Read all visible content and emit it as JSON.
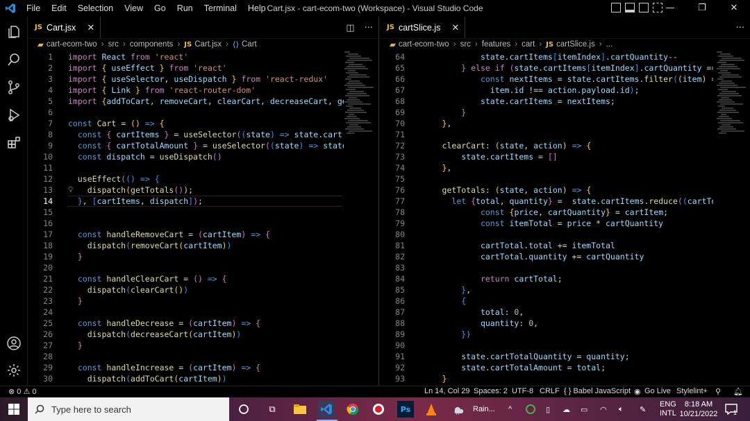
{
  "window": {
    "title": "Cart.jsx - cart-ecom-two (Workspace) - Visual Studio Code",
    "menu": [
      "File",
      "Edit",
      "Selection",
      "View",
      "Go",
      "Run",
      "Terminal",
      "Help"
    ]
  },
  "left_editor": {
    "tab_label": "Cart.jsx",
    "tab_badge": "JS",
    "breadcrumb": [
      "cart-ecom-two",
      "src",
      "components",
      "Cart.jsx",
      "Cart"
    ],
    "cursor_line": 14,
    "lines": [
      {
        "n": "1",
        "html": "<span class='kw2'>import</span> <span class='var'>React</span> <span class='kw2'>from</span> <span class='str'>'react'</span>"
      },
      {
        "n": "2",
        "html": "<span class='kw2'>import</span> <span class='br1'>{</span> <span class='var'>useEffect</span> <span class='br1'>}</span> <span class='kw2'>from</span> <span class='str'>'react'</span>"
      },
      {
        "n": "3",
        "html": "<span class='kw2'>import</span> <span class='br1'>{</span> <span class='var'>useSelector</span>, <span class='var'>useDispatch</span> <span class='br1'>}</span> <span class='kw2'>from</span> <span class='str'>'react-redux'</span>"
      },
      {
        "n": "4",
        "html": "<span class='kw2'>import</span> <span class='br1'>{</span> <span class='var'>Link</span> <span class='br1'>}</span> <span class='kw2'>from</span> <span class='str'>'react-router-dom'</span>"
      },
      {
        "n": "5",
        "html": "<span class='kw2'>import</span> <span class='br1'>{</span><span class='var'>addToCart</span>, <span class='var'>removeCart</span>, <span class='var'>clearCart</span>, <span class='var'>decreaseCart</span>, <span class='var'>getTo</span>"
      },
      {
        "n": "6",
        "html": ""
      },
      {
        "n": "7",
        "html": "<span class='kw'>const</span> <span class='fn'>Cart</span> = <span class='br1'>()</span> <span class='kw'>=&gt;</span> <span class='br1'>{</span>"
      },
      {
        "n": "8",
        "html": "  <span class='kw'>const</span> <span class='br2'>{</span> <span class='var'>cartItems</span> <span class='br2'>}</span> = <span class='fn'>useSelector</span><span class='br2'>(</span><span class='br3'>(</span><span class='var'>state</span><span class='br3'>)</span> <span class='kw'>=&gt;</span> <span class='var'>state</span>.<span class='prop'>cart</span><span class='br2'>)</span>"
      },
      {
        "n": "9",
        "html": "  <span class='kw'>const</span> <span class='br2'>{</span> <span class='var'>cartTotalAmount</span> <span class='br2'>}</span> = <span class='fn'>useSelector</span><span class='br2'>(</span><span class='br3'>(</span><span class='var'>state</span><span class='br3'>)</span> <span class='kw'>=&gt;</span> <span class='var'>state</span>.<span class='prop'>ca</span>"
      },
      {
        "n": "10",
        "html": "  <span class='kw'>const</span> <span class='var'>dispatch</span> = <span class='fn'>useDispatch</span><span class='br2'>()</span>"
      },
      {
        "n": "11",
        "html": ""
      },
      {
        "n": "12",
        "html": "  <span class='fn'>useEffect</span><span class='br2'>(</span><span class='br3'>()</span> <span class='kw'>=&gt;</span> <span class='br3'>{</span>"
      },
      {
        "n": "13",
        "html": "    <span class='fn'>dispatch</span><span class='br1'>(</span><span class='fn'>getTotals</span><span class='br2'>()</span><span class='br1'>)</span>;"
      },
      {
        "n": "14",
        "html": "  <span class='br3'>}</span>, <span class='br3'>[</span><span class='var'>cartItems</span>, <span class='var'>dispatch</span><span class='br3'>]</span><span class='br2'>)</span>;"
      },
      {
        "n": "15",
        "html": ""
      },
      {
        "n": "16",
        "html": ""
      },
      {
        "n": "17",
        "html": "  <span class='kw'>const</span> <span class='fn'>handleRemoveCart</span> = <span class='br2'>(</span><span class='var'>cartItem</span><span class='br2'>)</span> <span class='kw'>=&gt;</span> <span class='br2'>{</span>"
      },
      {
        "n": "18",
        "html": "    <span class='fn'>dispatch</span><span class='br3'>(</span><span class='fn'>removeCart</span><span class='br1'>(</span><span class='var'>cartItem</span><span class='br1'>)</span><span class='br3'>)</span>"
      },
      {
        "n": "19",
        "html": "  <span class='br2'>}</span>"
      },
      {
        "n": "20",
        "html": ""
      },
      {
        "n": "21",
        "html": "  <span class='kw'>const</span> <span class='fn'>handleClearCart</span> = <span class='br2'>()</span> <span class='kw'>=&gt;</span> <span class='br2'>{</span>"
      },
      {
        "n": "22",
        "html": "    <span class='fn'>dispatch</span><span class='br3'>(</span><span class='fn'>clearCart</span><span class='br1'>()</span><span class='br3'>)</span>"
      },
      {
        "n": "23",
        "html": "  <span class='br2'>}</span>"
      },
      {
        "n": "24",
        "html": ""
      },
      {
        "n": "25",
        "html": "  <span class='kw'>const</span> <span class='fn'>handleDecrease</span> = <span class='br2'>(</span><span class='var'>cartItem</span><span class='br2'>)</span> <span class='kw'>=&gt;</span> <span class='br2'>{</span>"
      },
      {
        "n": "26",
        "html": "    <span class='fn'>dispatch</span><span class='br3'>(</span><span class='fn'>decreaseCart</span><span class='br1'>(</span><span class='var'>cartItem</span><span class='br1'>)</span><span class='br3'>)</span>"
      },
      {
        "n": "27",
        "html": "  <span class='br2'>}</span>"
      },
      {
        "n": "28",
        "html": ""
      },
      {
        "n": "29",
        "html": "  <span class='kw'>const</span> <span class='fn'>handleIncrease</span> = <span class='br2'>(</span><span class='var'>cartItem</span><span class='br2'>)</span> <span class='kw'>=&gt;</span> <span class='br2'>{</span>"
      },
      {
        "n": "30",
        "html": "    <span class='fn'>dispatch</span><span class='br3'>(</span><span class='fn'>addToCart</span><span class='br1'>(</span><span class='var'>cartItem</span><span class='br1'>)</span><span class='br3'>)</span>"
      }
    ]
  },
  "right_editor": {
    "tab_label": "cartSlice.js",
    "tab_badge": "JS",
    "breadcrumb": [
      "cart-ecom-two",
      "src",
      "features",
      "cart",
      "cartSlice.js",
      "..."
    ],
    "lines": [
      {
        "n": "64",
        "html": "              <span class='var'>state</span>.<span class='prop'>cartItems</span><span class='br3'>[</span><span class='var'>itemIndex</span><span class='br3'>]</span>.<span class='prop'>cartQuantity</span>--"
      },
      {
        "n": "65",
        "html": "          <span class='br2'>}</span> <span class='kw2'>else</span> <span class='kw2'>if</span> <span class='br2'>(</span><span class='var'>state</span>.<span class='prop'>cartItems</span><span class='br3'>[</span><span class='var'>itemIndex</span><span class='br3'>]</span>.<span class='prop'>cartQuantity</span> =="
      },
      {
        "n": "66",
        "html": "              <span class='kw'>const</span> <span class='var'>nextItems</span> = <span class='var'>state</span>.<span class='prop'>cartItems</span>.<span class='fn'>filter</span><span class='br3'>(</span><span class='br1'>(</span><span class='var'>item</span><span class='br1'>)</span> ="
      },
      {
        "n": "67",
        "html": "                <span class='var'>item</span>.<span class='prop'>id</span> !== <span class='var'>action</span>.<span class='prop'>payload</span>.<span class='prop'>id</span><span class='br3'>)</span>;"
      },
      {
        "n": "68",
        "html": "              <span class='var'>state</span>.<span class='prop'>cartItems</span> = <span class='var'>nextItems</span>;"
      },
      {
        "n": "69",
        "html": "          <span class='br2'>}</span>"
      },
      {
        "n": "70",
        "html": "      <span class='br1'>}</span>,"
      },
      {
        "n": "71",
        "html": ""
      },
      {
        "n": "72",
        "html": "      <span class='fn'>clearCart</span>: <span class='br1'>(</span><span class='var'>state</span>, <span class='var'>action</span><span class='br1'>)</span> <span class='kw'>=&gt;</span> <span class='br1'>{</span>"
      },
      {
        "n": "73",
        "html": "          <span class='var'>state</span>.<span class='prop'>cartItems</span> = <span class='br2'>[]</span>"
      },
      {
        "n": "74",
        "html": "      <span class='br1'>}</span>,"
      },
      {
        "n": "75",
        "html": ""
      },
      {
        "n": "76",
        "html": "      <span class='fn'>getTotals</span>: <span class='br1'>(</span><span class='var'>state</span>, <span class='var'>action</span><span class='br1'>)</span> <span class='kw'>=&gt;</span> <span class='br1'>{</span>"
      },
      {
        "n": "77",
        "html": "        <span class='kw'>let</span> <span class='br2'>{</span><span class='var'>total</span>, <span class='var'>quantity</span><span class='br2'>}</span> =  <span class='var'>state</span>.<span class='prop'>cartItems</span>.<span class='fn'>reduce</span><span class='br2'>(</span><span class='br3'>(</span><span class='var'>cartTo</span>"
      },
      {
        "n": "78",
        "html": "              <span class='kw'>const</span> <span class='br1'>{</span><span class='var'>price</span>, <span class='var'>cartQuantity</span><span class='br1'>}</span> = <span class='var'>cartItem</span>;"
      },
      {
        "n": "79",
        "html": "              <span class='kw'>const</span> <span class='var'>itemTotal</span> = <span class='var'>price</span> * <span class='var'>cartQuantity</span>"
      },
      {
        "n": "80",
        "html": ""
      },
      {
        "n": "81",
        "html": "              <span class='var'>cartTotal</span>.<span class='prop'>total</span> += <span class='var'>itemTotal</span>"
      },
      {
        "n": "82",
        "html": "              <span class='var'>cartTotal</span>.<span class='prop'>quantity</span> += <span class='var'>cartQuantity</span>"
      },
      {
        "n": "83",
        "html": ""
      },
      {
        "n": "84",
        "html": "              <span class='kw2'>return</span> <span class='var'>cartTotal</span>;"
      },
      {
        "n": "85",
        "html": "          <span class='br3'>}</span>,"
      },
      {
        "n": "86",
        "html": "          <span class='br3'>{</span>"
      },
      {
        "n": "87",
        "html": "              <span class='prop'>total</span>: <span class='num'>0</span>,"
      },
      {
        "n": "88",
        "html": "              <span class='prop'>quantity</span>: <span class='num'>0</span>,"
      },
      {
        "n": "89",
        "html": "          <span class='br3'>}</span><span class='br2'>)</span>"
      },
      {
        "n": "90",
        "html": ""
      },
      {
        "n": "91",
        "html": "          <span class='var'>state</span>.<span class='prop'>cartTotalQuantity</span> = <span class='var'>quantity</span>;"
      },
      {
        "n": "92",
        "html": "          <span class='var'>state</span>.<span class='prop'>cartTotalAmount</span> = <span class='var'>total</span>;"
      },
      {
        "n": "93",
        "html": "      <span class='br1'>}</span>"
      }
    ]
  },
  "statusbar": {
    "problems": "⊗ 0 ⚠ 0",
    "position": "Ln 14, Col 29",
    "spaces": "Spaces: 2",
    "encoding": "UTF-8",
    "eol": "CRLF",
    "language": "{ }  Babel JavaScript",
    "golive": "Go Live",
    "stylelint": "Stylelint+"
  },
  "taskbar": {
    "search_placeholder": "Type here to search",
    "weather": "Rain...",
    "lang_line1": "ENG",
    "lang_line2": "INTL",
    "time": "8:18 AM",
    "date": "10/21/2022",
    "notification_count": "1"
  },
  "colors": {
    "accent_tab": "#f0a020",
    "js_badge": "#e8c33a",
    "vscode_blue": "#2f8ae0"
  }
}
